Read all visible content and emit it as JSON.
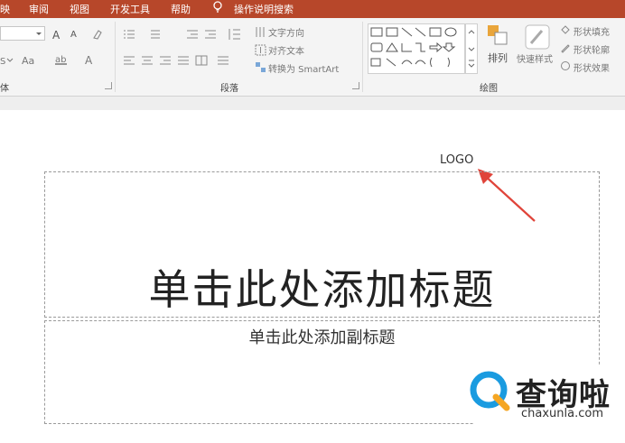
{
  "menubar": {
    "items": [
      "映",
      "审阅",
      "视图",
      "开发工具",
      "帮助"
    ],
    "tell_me": "操作说明搜索",
    "bg_color": "#b7472a"
  },
  "ribbon": {
    "font_group": {
      "label": "体",
      "row1": [
        "A",
        "A"
      ],
      "row2": [
        "Aa",
        "A"
      ]
    },
    "paragraph_group": {
      "label": "段落",
      "text_direction": "文字方向",
      "align_text": "对齐文本",
      "convert_smartart": "转换为 SmartArt"
    },
    "drawing_group": {
      "label": "绘图",
      "arrange": "排列",
      "quick_styles": "快速样式",
      "shape_fill": "形状填充",
      "shape_outline": "形状轮廓",
      "shape_effects": "形状效果"
    }
  },
  "slide": {
    "logo": "LOGO",
    "title_placeholder": "单击此处添加标题",
    "subtitle_placeholder": "单击此处添加副标题",
    "arrow_color": "#e0443a"
  },
  "watermark": {
    "cn": "查询啦",
    "en": "chaxunla.com",
    "accent": "#1a9be0"
  }
}
